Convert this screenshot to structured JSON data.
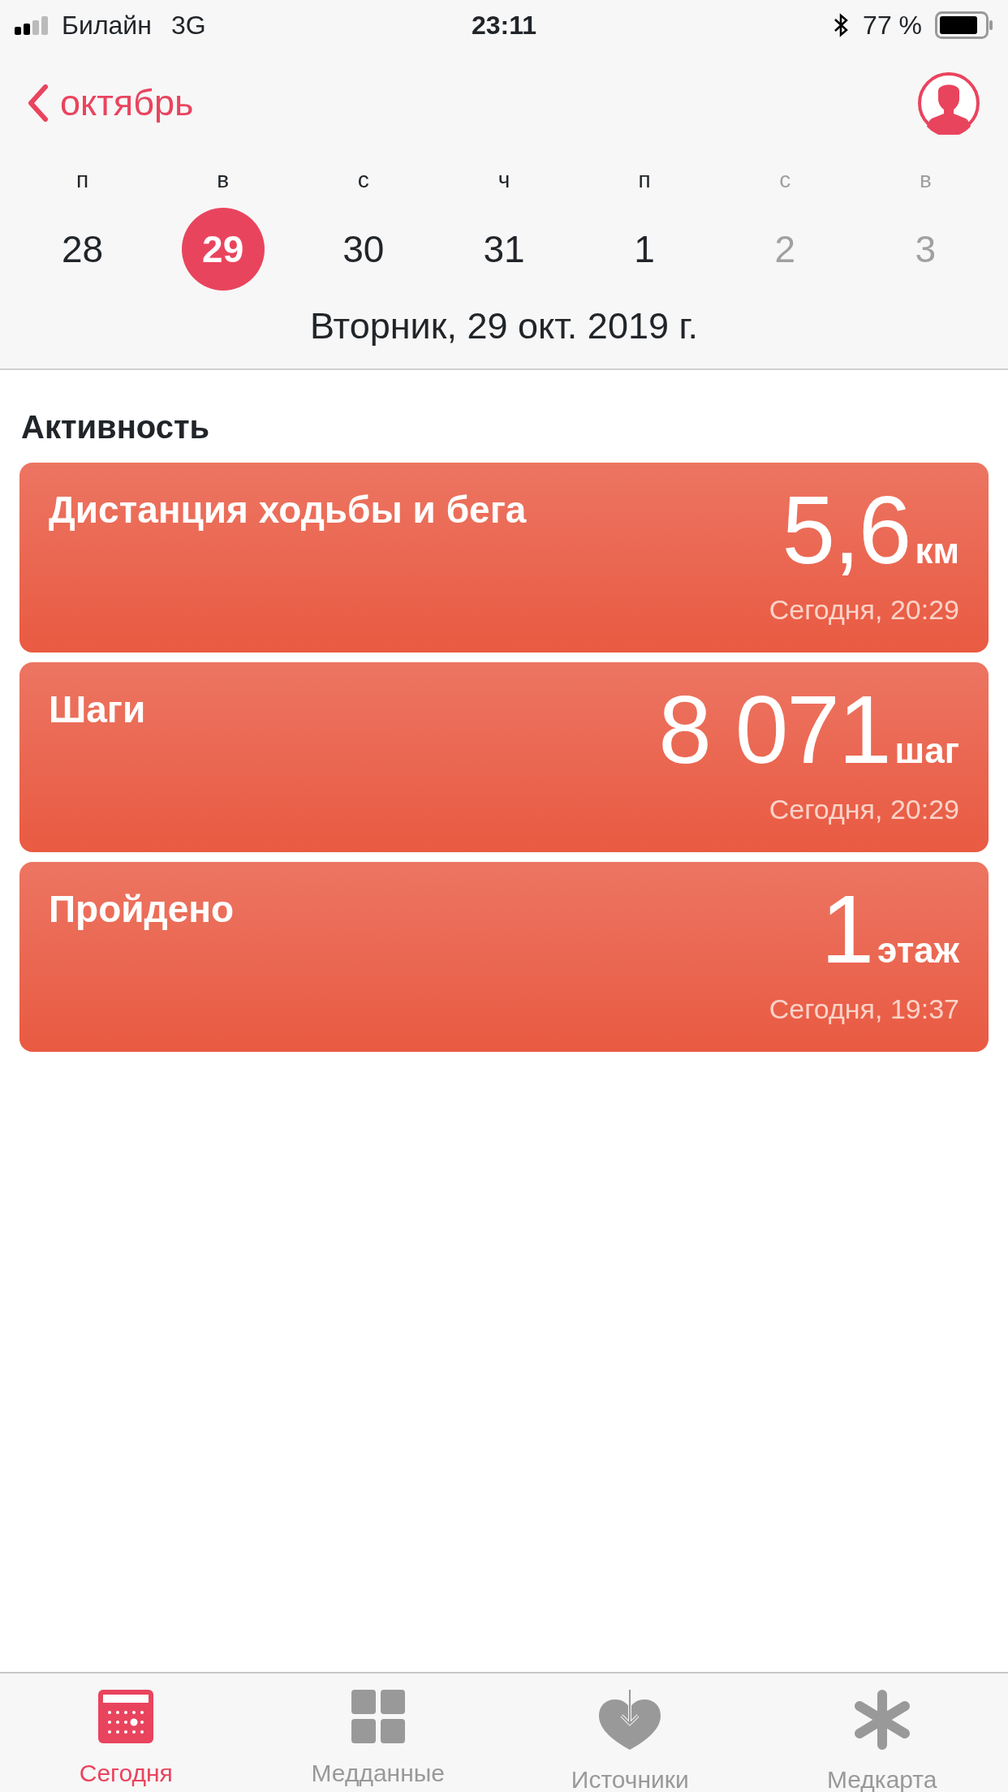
{
  "status_bar": {
    "carrier": "Билайн",
    "network": "3G",
    "time": "23:11",
    "battery": "77 %"
  },
  "nav": {
    "back": "октябрь"
  },
  "week": [
    {
      "weekday": "п",
      "day": "28",
      "selected": false,
      "dimmed": false
    },
    {
      "weekday": "в",
      "day": "29",
      "selected": true,
      "dimmed": false
    },
    {
      "weekday": "с",
      "day": "30",
      "selected": false,
      "dimmed": false
    },
    {
      "weekday": "ч",
      "day": "31",
      "selected": false,
      "dimmed": false
    },
    {
      "weekday": "п",
      "day": "1",
      "selected": false,
      "dimmed": false
    },
    {
      "weekday": "с",
      "day": "2",
      "selected": false,
      "dimmed": true
    },
    {
      "weekday": "в",
      "day": "3",
      "selected": false,
      "dimmed": true
    }
  ],
  "date_title": "Вторник, 29 окт. 2019 г.",
  "section_title": "Активность",
  "cards": [
    {
      "title": "Дистанция ходьбы и бега",
      "value": "5,6",
      "unit": "км",
      "time": "Сегодня, 20:29"
    },
    {
      "title": "Шаги",
      "value": "8 071",
      "unit": "шаг",
      "time": "Сегодня, 20:29"
    },
    {
      "title": "Пройдено",
      "value": "1",
      "unit": "этаж",
      "time": "Сегодня, 19:37"
    }
  ],
  "tabs": [
    {
      "kind": "calendar",
      "label": "Сегодня",
      "selected": true
    },
    {
      "kind": "grid",
      "label": "Медданные",
      "selected": false
    },
    {
      "kind": "heart",
      "label": "Источники",
      "selected": false
    },
    {
      "kind": "asterisk",
      "label": "Медкарта",
      "selected": false
    }
  ]
}
